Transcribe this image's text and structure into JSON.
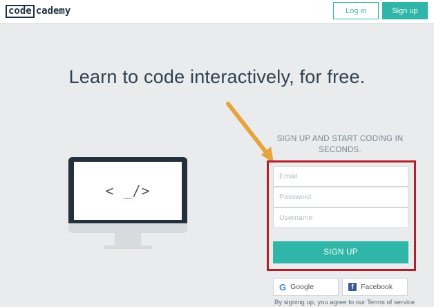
{
  "header": {
    "logo_part1": "code",
    "logo_part2": "cademy",
    "login_label": "Log in",
    "signup_label": "Sign up"
  },
  "hero": {
    "headline": "Learn to code interactively, for free.",
    "code_left": "< ",
    "code_cursor": "_",
    "code_right": "/>"
  },
  "signup": {
    "tagline": "SIGN UP AND START CODING IN SECONDS.",
    "email_placeholder": "Email",
    "password_placeholder": "Password",
    "username_placeholder": "Username",
    "submit_label": "SIGN UP",
    "google_label": "Google",
    "facebook_label": "Facebook",
    "terms_text": "By signing up, you agree to our Terms of service"
  },
  "colors": {
    "accent": "#30b6a8",
    "highlight_border": "#b3202a",
    "arrow": "#e8a33a",
    "background": "#e9ebec"
  }
}
